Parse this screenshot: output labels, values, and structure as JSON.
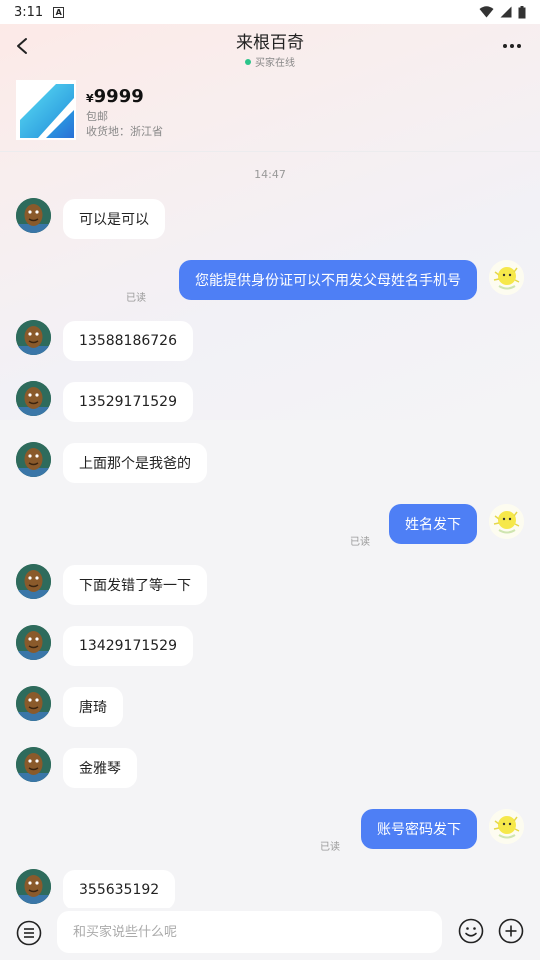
{
  "status_bar": {
    "time": "3:11"
  },
  "header": {
    "title": "来根百奇",
    "online_status": "买家在线"
  },
  "product": {
    "currency": "¥",
    "price": "9999",
    "shipping": "包邮",
    "location": "收货地：浙江省"
  },
  "chat": {
    "timestamp": "14:47",
    "read_label": "已读",
    "messages": [
      {
        "text": "可以是可以"
      },
      {
        "text": "您能提供身份证可以不用发父母姓名手机号"
      },
      {
        "text": "13588186726"
      },
      {
        "text": "13529171529"
      },
      {
        "text": "上面那个是我爸的"
      },
      {
        "text": "姓名发下"
      },
      {
        "text": "下面发错了等一下"
      },
      {
        "text": "13429171529"
      },
      {
        "text": "唐琦"
      },
      {
        "text": "金雅琴"
      },
      {
        "text": "账号密码发下"
      },
      {
        "text": "355635192"
      }
    ]
  },
  "input_bar": {
    "placeholder": "和买家说些什么呢"
  },
  "colors": {
    "outgoing_bubble": "#4e7ff5",
    "online_dot": "#2bc48a"
  }
}
